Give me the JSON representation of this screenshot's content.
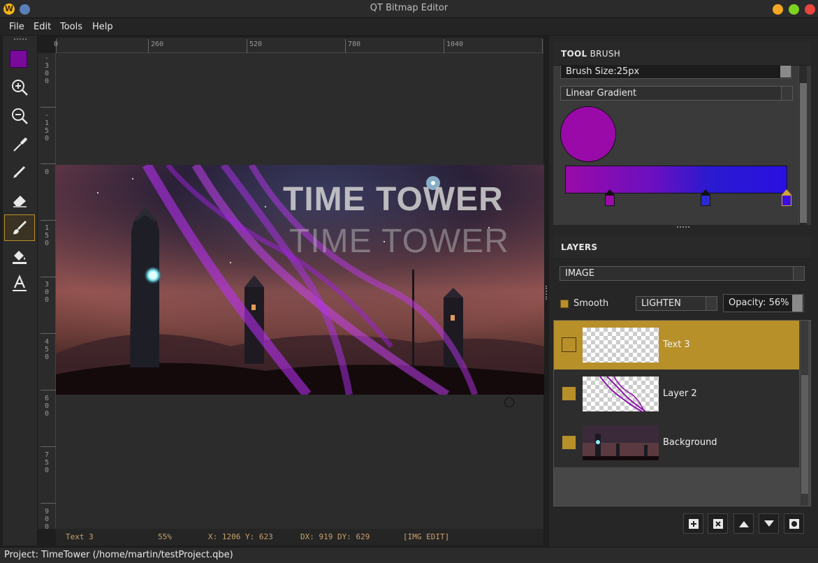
{
  "window": {
    "title": "QT Bitmap Editor",
    "logo_letter": "W"
  },
  "menu": [
    "File",
    "Edit",
    "Tools",
    "Help"
  ],
  "toolbar": {
    "active_color": "#7a0a9b",
    "tools": [
      "zoom-in-icon",
      "zoom-out-icon",
      "eyedropper-icon",
      "pencil-icon",
      "eraser-icon",
      "brush-icon",
      "fill-bucket-icon",
      "text-tool-icon"
    ],
    "active_tool": "brush-icon"
  },
  "ruler": {
    "top_labels": [
      "0",
      "260",
      "520",
      "780",
      "1040"
    ],
    "left_labels": [
      "-300",
      "-150",
      "0",
      "150",
      "300",
      "450",
      "600",
      "750",
      "900"
    ]
  },
  "artwork": {
    "line1": "TIME TOWER",
    "line2": "TIME TOWER"
  },
  "status": {
    "layer": "Text 3",
    "zoom": "55%",
    "coords": "X: 1206 Y: 623",
    "delta": "DX: 919 DY: 629",
    "mode": "[IMG EDIT]"
  },
  "project": {
    "text": "Project: TimeTower (/home/martin/testProject.qbe)"
  },
  "tool_panel": {
    "header_bold": "TOOL",
    "header_rest": "BRUSH",
    "brush_size": "Brush Size:25px",
    "gradient_type": "Linear Gradient",
    "preview_color": "#9a0aa8",
    "gradient_stops": [
      "#9a0aa8",
      "#2a1ad0",
      "#2a10e0"
    ]
  },
  "layers_panel": {
    "header": "LAYERS",
    "type_select": "IMAGE",
    "smooth_label": "Smooth",
    "blend_mode": "LIGHTEN",
    "opacity": "Opacity: 56%",
    "layers": [
      {
        "name": "Text 3",
        "selected": true,
        "visible": false
      },
      {
        "name": "Layer 2",
        "selected": false,
        "visible": true
      },
      {
        "name": "Background",
        "selected": false,
        "visible": true
      }
    ],
    "actions": [
      "add-layer-icon",
      "delete-layer-icon",
      "move-up-icon",
      "move-down-icon",
      "mask-icon"
    ]
  }
}
